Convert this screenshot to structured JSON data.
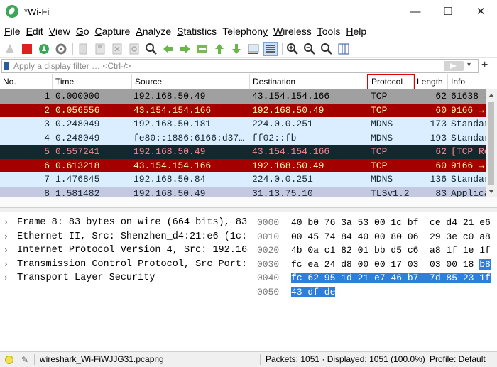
{
  "window": {
    "title": "*Wi-Fi",
    "minimize": "—",
    "maximize": "☐",
    "close": "✕"
  },
  "menu": [
    {
      "label": "File",
      "acc": "F",
      "rest": "ile"
    },
    {
      "label": "Edit",
      "acc": "E",
      "rest": "dit"
    },
    {
      "label": "View",
      "acc": "V",
      "rest": "iew"
    },
    {
      "label": "Go",
      "acc": "G",
      "rest": "o"
    },
    {
      "label": "Capture",
      "acc": "C",
      "rest": "apture"
    },
    {
      "label": "Analyze",
      "acc": "A",
      "rest": "nalyze"
    },
    {
      "label": "Statistics",
      "acc": "S",
      "rest": "tatistics"
    },
    {
      "label": "Telephony",
      "pre": "Telephon",
      "acc": "y",
      "rest": ""
    },
    {
      "label": "Wireless",
      "acc": "W",
      "rest": "ireless"
    },
    {
      "label": "Tools",
      "acc": "T",
      "rest": "ools"
    },
    {
      "label": "Help",
      "acc": "H",
      "rest": "elp"
    }
  ],
  "filter": {
    "placeholder": "Apply a display filter … <Ctrl-/>",
    "value": ""
  },
  "columns": [
    "No.",
    "Time",
    "Source",
    "Destination",
    "Protocol",
    "Length",
    "Info"
  ],
  "packets": [
    {
      "no": "1",
      "time": "0.000000",
      "src": "192.168.50.49",
      "dst": "43.154.154.166",
      "proto": "TCP",
      "len": "62",
      "info": "61638 →",
      "bg": "#a0a0a0",
      "fg": "#000000"
    },
    {
      "no": "2",
      "time": "0.056556",
      "src": "43.154.154.166",
      "dst": "192.168.50.49",
      "proto": "TCP",
      "len": "60",
      "info": "9166 →",
      "bg": "#a40000",
      "fg": "#fffc9c"
    },
    {
      "no": "3",
      "time": "0.248049",
      "src": "192.168.50.181",
      "dst": "224.0.0.251",
      "proto": "MDNS",
      "len": "173",
      "info": "Standar",
      "bg": "#daeeff",
      "fg": "#12272e"
    },
    {
      "no": "4",
      "time": "0.248049",
      "src": "fe80::1886:6166:d37…",
      "dst": "ff02::fb",
      "proto": "MDNS",
      "len": "193",
      "info": "Standar",
      "bg": "#daeeff",
      "fg": "#12272e"
    },
    {
      "no": "5",
      "time": "0.557241",
      "src": "192.168.50.49",
      "dst": "43.154.154.166",
      "proto": "TCP",
      "len": "62",
      "info": "[TCP Re",
      "bg": "#12272e",
      "fg": "#f78787"
    },
    {
      "no": "6",
      "time": "0.613218",
      "src": "43.154.154.166",
      "dst": "192.168.50.49",
      "proto": "TCP",
      "len": "60",
      "info": "9166 →",
      "bg": "#a40000",
      "fg": "#fffc9c"
    },
    {
      "no": "7",
      "time": "1.476845",
      "src": "192.168.50.84",
      "dst": "224.0.0.251",
      "proto": "MDNS",
      "len": "136",
      "info": "Standar",
      "bg": "#daeeff",
      "fg": "#12272e"
    },
    {
      "no": "8",
      "time": "1.581482",
      "src": "192.168.50.49",
      "dst": "31.13.75.10",
      "proto": "TLSv1.2",
      "len": "83",
      "info": "Applica",
      "bg": "#c4c8e0",
      "fg": "#12272e"
    }
  ],
  "details": [
    "Frame 8: 83 bytes on wire (664 bits), 83",
    "Ethernet II, Src: Shenzhen_d4:21:e6 (1c:b",
    "Internet Protocol Version 4, Src: 192.168",
    "Transmission Control Protocol, Src Port: ",
    "Transport Layer Security"
  ],
  "bytes": [
    {
      "offset": "0000",
      "hex": "40 b0 76 3a 53 00 1c bf  ce d4 21 e6"
    },
    {
      "offset": "0010",
      "hex": "00 45 74 84 40 00 80 06  29 3e c0 a8"
    },
    {
      "offset": "0020",
      "hex": "4b 0a c1 82 01 bb d5 c6  a8 1f 1e 1f"
    },
    {
      "offset": "0030",
      "hex": "fc ea 24 d8 00 00 17 03  03 00 18 ",
      "sel": "b8"
    },
    {
      "offset": "0040",
      "hex": "",
      "sel": "fc 62 95 1d 21 e7 46 b7  7d 85 23 1f"
    },
    {
      "offset": "0050",
      "hex": "",
      "sel": "43 df de"
    }
  ],
  "status": {
    "file": "wireshark_Wi-FiWJJG31.pcapng",
    "packets": "Packets: 1051 · Displayed: 1051 (100.0%)",
    "profile": "Profile: Default"
  },
  "colors": {
    "selection": "#2e7fd9",
    "highlight_box": "#e00000"
  }
}
